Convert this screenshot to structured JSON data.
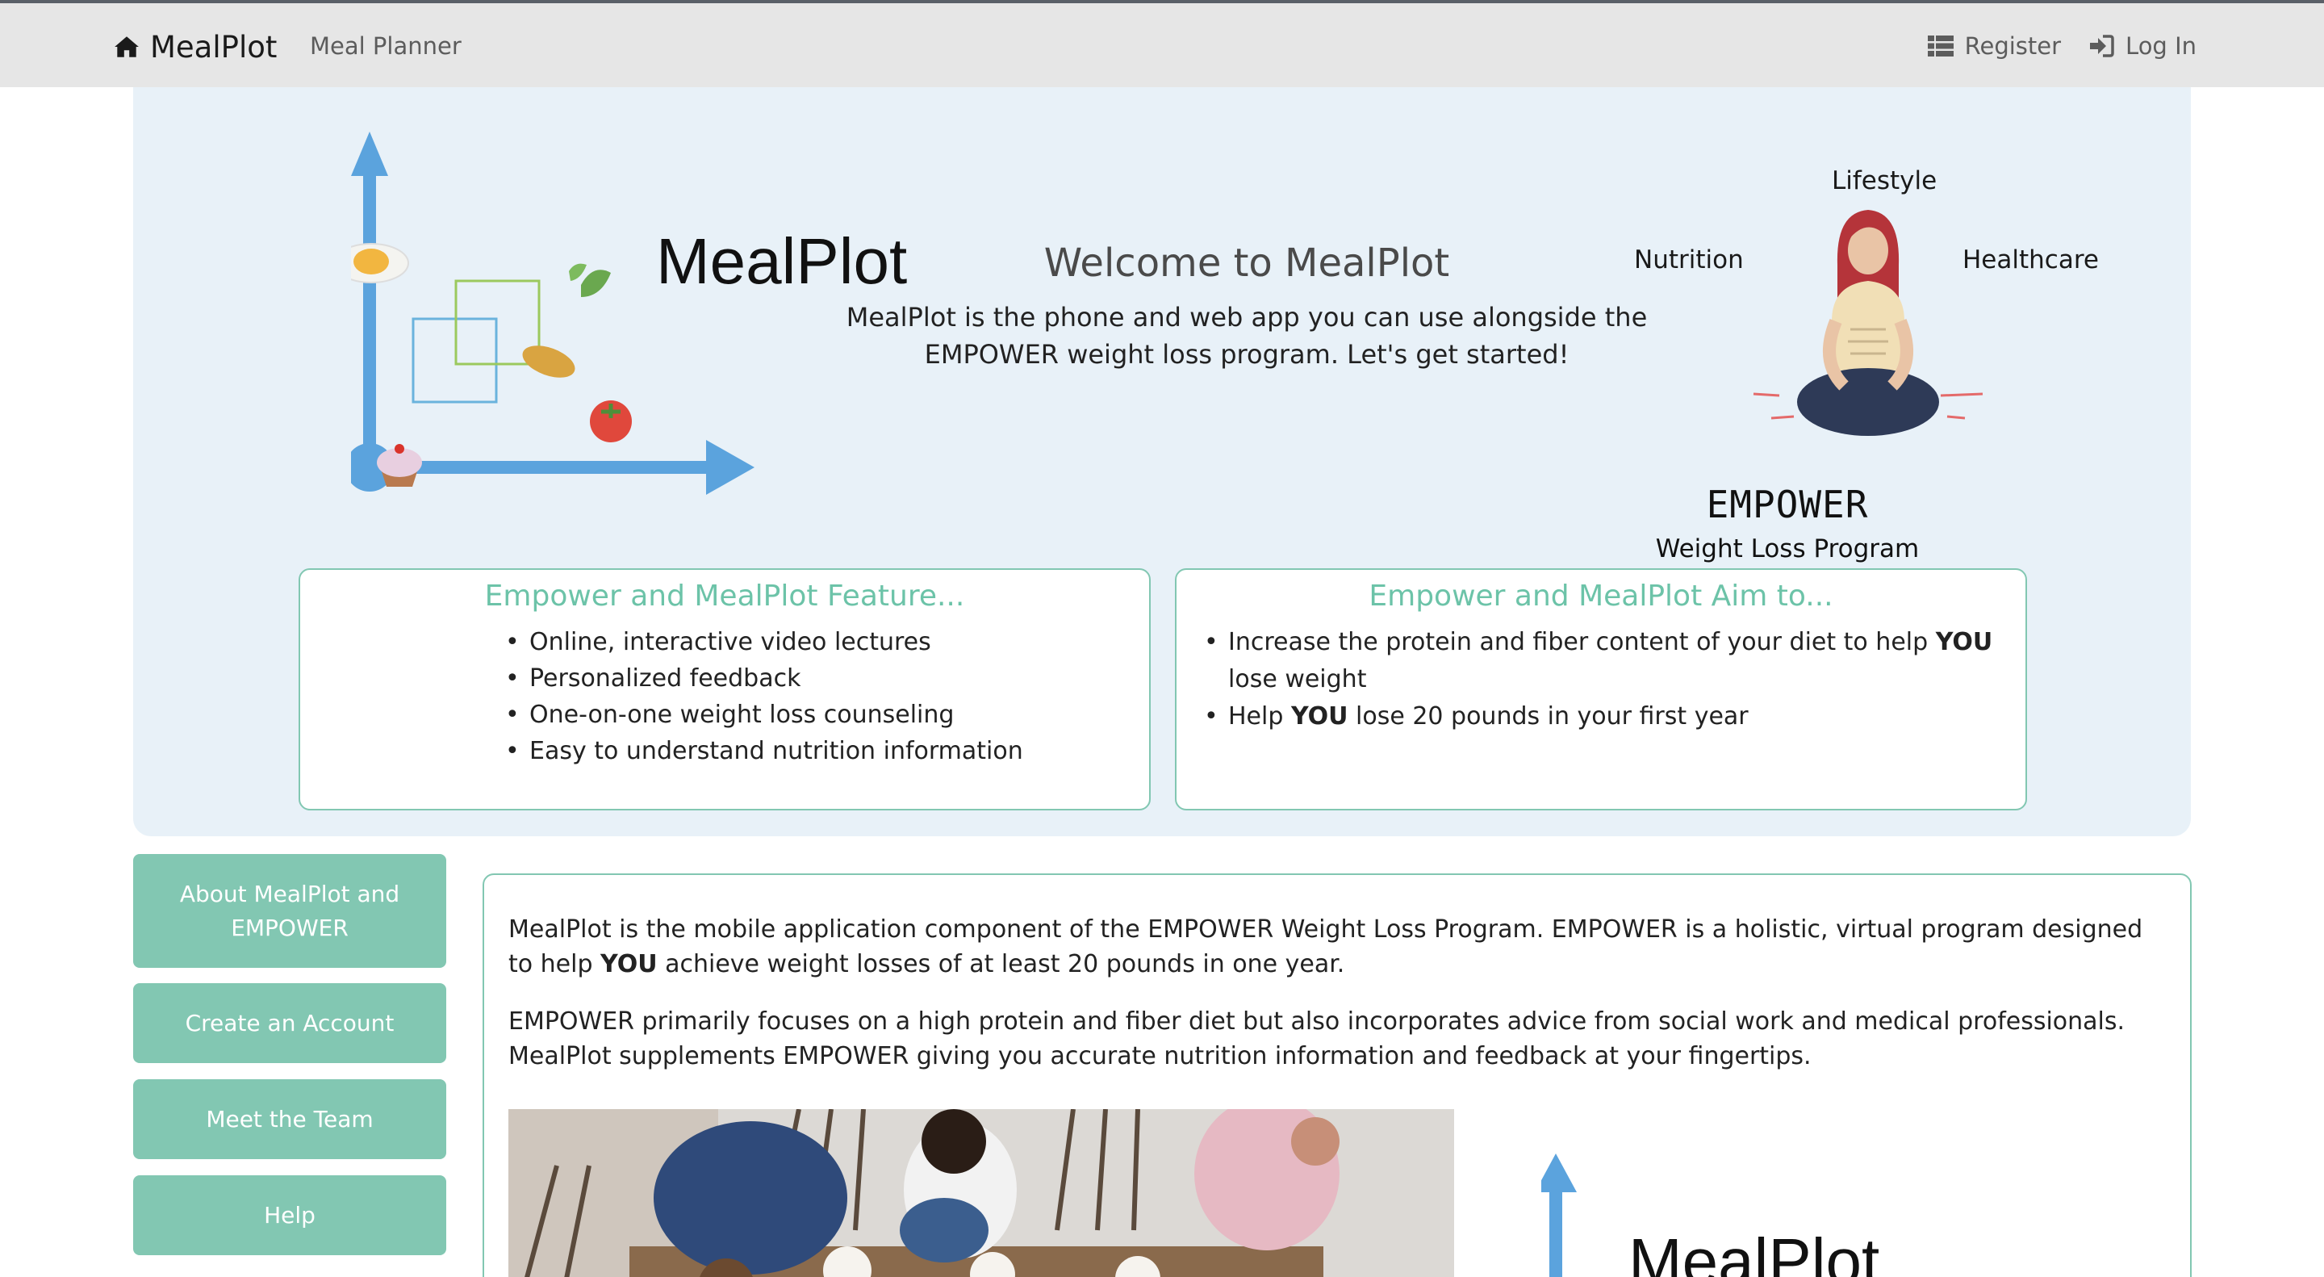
{
  "nav": {
    "brand": "MealPlot",
    "planner": "Meal Planner",
    "register": "Register",
    "login": "Log In",
    "icons": [
      "home-icon",
      "list-icon",
      "sign-in-icon"
    ]
  },
  "hero": {
    "logo_text": "MealPlot",
    "welcome_title": "Welcome to MealPlot",
    "welcome_text": "MealPlot is the phone and web app you can use alongside the EMPOWER weight loss program. Let's get started!",
    "empower": {
      "lifestyle": "Lifestyle",
      "nutrition": "Nutrition",
      "healthcare": "Healthcare",
      "title": "EMPOWER",
      "subtitle": "Weight Loss Program"
    },
    "features": {
      "title": "Empower and MealPlot Feature...",
      "items": [
        "Online, interactive video lectures",
        "Personalized feedback",
        "One-on-one weight loss counseling",
        "Easy to understand nutrition information"
      ]
    },
    "aims": {
      "title": "Empower and MealPlot Aim to...",
      "item1_pre": "Increase the protein and fiber content of your diet to help ",
      "item1_bold": "YOU",
      "item1_post": " lose weight",
      "item2_pre": "Help ",
      "item2_bold": "YOU",
      "item2_post": " lose 20 pounds in your first year"
    }
  },
  "sidebar": {
    "items": [
      {
        "label": "About MealPlot and EMPOWER"
      },
      {
        "label": "Create an Account"
      },
      {
        "label": "Meet the Team"
      },
      {
        "label": "Help"
      }
    ]
  },
  "content": {
    "p1_pre": "MealPlot is the mobile application component of the EMPOWER Weight Loss Program. EMPOWER is a holistic, virtual program designed to help ",
    "p1_bold": "YOU",
    "p1_post": " achieve weight losses of at least 20 pounds in one year.",
    "p2": "EMPOWER primarily focuses on a high protein and fiber diet but also incorporates advice from social work and medical professionals. MealPlot supplements EMPOWER giving you accurate nutrition information and feedback at your fingertips.",
    "logo_text": "MealPlot"
  },
  "colors": {
    "accent": "#82c7b2",
    "accent_text": "#6cc3a8",
    "hero_bg": "#e8f1f8",
    "arrow_blue": "#5ba3dd",
    "navbar_bg": "#e6e6e6"
  }
}
